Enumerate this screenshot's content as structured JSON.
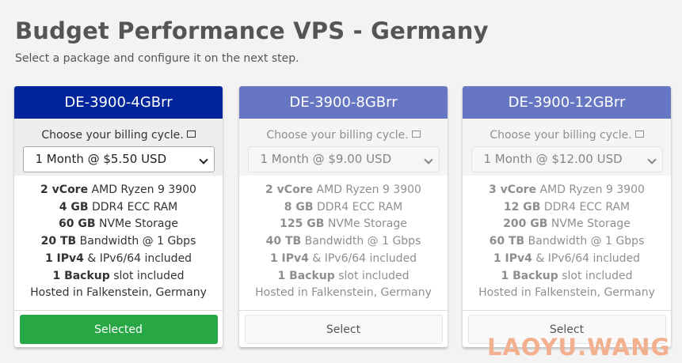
{
  "page": {
    "title": "Budget Performance VPS - Germany",
    "subtitle": "Select a package and configure it on the next step."
  },
  "cards": [
    {
      "name": "DE-3900-4GBrr",
      "billing_label": "Choose your billing cycle.",
      "billing_value": "1 Month @ $5.50 USD",
      "features": [
        {
          "bold": "2 vCore",
          "text": " AMD Ryzen 9 3900"
        },
        {
          "bold": "4 GB",
          "text": " DDR4 ECC RAM"
        },
        {
          "bold": "60 GB",
          "text": " NVMe Storage"
        },
        {
          "bold": "20 TB",
          "text": " Bandwidth @ 1 Gbps"
        },
        {
          "bold": "1 IPv4",
          "text": " & IPv6/64 included"
        },
        {
          "bold": "1 Backup",
          "text": " slot included"
        },
        {
          "bold": "",
          "text": "Hosted in Falkenstein, Germany"
        }
      ],
      "button_label": "Selected",
      "selected": true
    },
    {
      "name": "DE-3900-8GBrr",
      "billing_label": "Choose your billing cycle.",
      "billing_value": "1 Month @ $9.00 USD",
      "features": [
        {
          "bold": "2 vCore",
          "text": " AMD Ryzen 9 3900"
        },
        {
          "bold": "8 GB",
          "text": " DDR4 ECC RAM"
        },
        {
          "bold": "125 GB",
          "text": " NVMe Storage"
        },
        {
          "bold": "40 TB",
          "text": " Bandwidth @ 1 Gbps"
        },
        {
          "bold": "1 IPv4",
          "text": " & IPv6/64 included"
        },
        {
          "bold": "1 Backup",
          "text": " slot included"
        },
        {
          "bold": "",
          "text": "Hosted in Falkenstein, Germany"
        }
      ],
      "button_label": "Select",
      "selected": false
    },
    {
      "name": "DE-3900-12GBrr",
      "billing_label": "Choose your billing cycle.",
      "billing_value": "1 Month @ $12.00 USD",
      "features": [
        {
          "bold": "3 vCore",
          "text": " AMD Ryzen 9 3900"
        },
        {
          "bold": "12 GB",
          "text": " DDR4 ECC RAM"
        },
        {
          "bold": "200 GB",
          "text": " NVMe Storage"
        },
        {
          "bold": "60 TB",
          "text": " Bandwidth @ 1 Gbps"
        },
        {
          "bold": "1 IPv4",
          "text": " & IPv6/64 included"
        },
        {
          "bold": "1 Backup",
          "text": " slot included"
        },
        {
          "bold": "",
          "text": "Hosted in Falkenstein, Germany"
        }
      ],
      "button_label": "Select",
      "selected": false
    }
  ],
  "watermark": "LAOYU.WANG",
  "colors": {
    "selected_header": "#00259a",
    "unselected_header": "#6676c2",
    "selected_button": "#28a745"
  }
}
